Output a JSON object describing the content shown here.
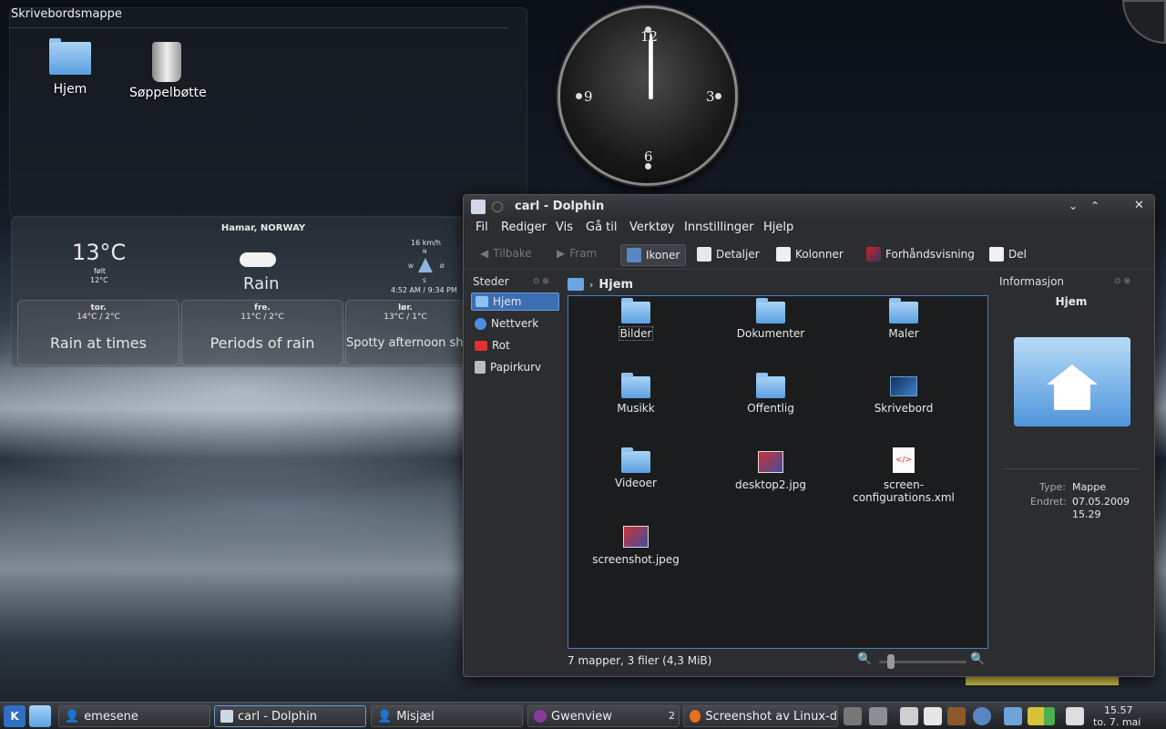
{
  "desktop": {
    "folderview_title": "Skrivebordsmappe",
    "icons": [
      {
        "label": "Hjem",
        "icon": "home-folder-icon"
      },
      {
        "label": "Søppelbøtte",
        "icon": "trash-icon"
      }
    ]
  },
  "clock": {
    "numerals": [
      "12",
      "3",
      "6",
      "9"
    ]
  },
  "weather": {
    "location": "Hamar, NORWAY",
    "current_temp": "13°C",
    "feels_label": "følt",
    "feels_temp": "12°C",
    "condition": "Rain",
    "wind": "16 km/h",
    "compass": [
      "N",
      "S",
      "W",
      "Ø"
    ],
    "sun": "4:52 AM / 9:34 PM",
    "forecast": [
      {
        "day": "tor.",
        "temps": "14°C / 2°C",
        "summary": "Rain at times"
      },
      {
        "day": "fre.",
        "temps": "11°C / 2°C",
        "summary": "Periods of rain"
      },
      {
        "day": "lør.",
        "temps": "13°C / 1°C",
        "summary": "Spotty afternoon showers"
      }
    ]
  },
  "dolphin": {
    "title": "carl - Dolphin",
    "menu": [
      "Fil",
      "Rediger",
      "Vis",
      "Gå til",
      "Verktøy",
      "Innstillinger",
      "Hjelp"
    ],
    "toolbar": {
      "back": "Tilbake",
      "forward": "Fram",
      "icons": "Ikoner",
      "details": "Detaljer",
      "columns": "Kolonner",
      "preview": "Forhåndsvisning",
      "split": "Del"
    },
    "places_title": "Steder",
    "places": [
      "Hjem",
      "Nettverk",
      "Rot",
      "Papirkurv"
    ],
    "breadcrumb": "Hjem",
    "files": [
      {
        "name": "Bilder",
        "type": "folder"
      },
      {
        "name": "Dokumenter",
        "type": "folder"
      },
      {
        "name": "Maler",
        "type": "folder"
      },
      {
        "name": "Musikk",
        "type": "folder"
      },
      {
        "name": "Offentlig",
        "type": "folder"
      },
      {
        "name": "Skrivebord",
        "type": "desktop"
      },
      {
        "name": "Videoer",
        "type": "folder"
      },
      {
        "name": "desktop2.jpg",
        "type": "image"
      },
      {
        "name": "screen-configurations.xml",
        "type": "xml"
      },
      {
        "name": "screenshot.jpeg",
        "type": "image"
      }
    ],
    "status": "7 mapper, 3 filer (4,3 MiB)",
    "info": {
      "title": "Informasjon",
      "name": "Hjem",
      "type_label": "Type:",
      "type_value": "Mappe",
      "modified_label": "Endret:",
      "modified_value": "07.05.2009",
      "modified_time": "15.29"
    }
  },
  "taskbar": {
    "tasks": [
      "emesene",
      "carl - Dolphin",
      "Misjæl",
      "Gwenview",
      "Screenshot av Linux-d"
    ],
    "desktop_number": "2",
    "time": "15.57",
    "date": "to. 7. mai"
  }
}
